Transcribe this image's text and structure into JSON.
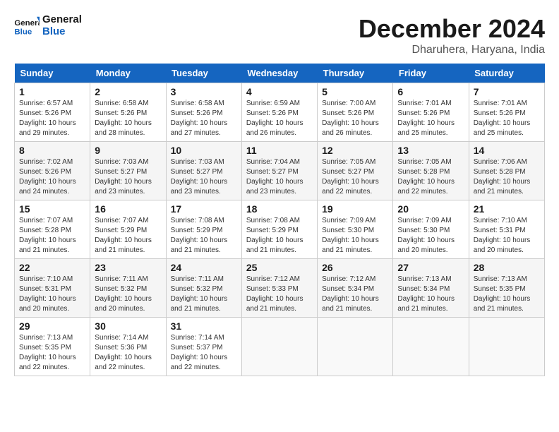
{
  "header": {
    "logo_general": "General",
    "logo_blue": "Blue",
    "month": "December 2024",
    "location": "Dharuhera, Haryana, India"
  },
  "calendar": {
    "days_of_week": [
      "Sunday",
      "Monday",
      "Tuesday",
      "Wednesday",
      "Thursday",
      "Friday",
      "Saturday"
    ],
    "weeks": [
      [
        {
          "day": "",
          "info": ""
        },
        {
          "day": "2",
          "info": "Sunrise: 6:58 AM\nSunset: 5:26 PM\nDaylight: 10 hours\nand 28 minutes."
        },
        {
          "day": "3",
          "info": "Sunrise: 6:58 AM\nSunset: 5:26 PM\nDaylight: 10 hours\nand 27 minutes."
        },
        {
          "day": "4",
          "info": "Sunrise: 6:59 AM\nSunset: 5:26 PM\nDaylight: 10 hours\nand 26 minutes."
        },
        {
          "day": "5",
          "info": "Sunrise: 7:00 AM\nSunset: 5:26 PM\nDaylight: 10 hours\nand 26 minutes."
        },
        {
          "day": "6",
          "info": "Sunrise: 7:01 AM\nSunset: 5:26 PM\nDaylight: 10 hours\nand 25 minutes."
        },
        {
          "day": "7",
          "info": "Sunrise: 7:01 AM\nSunset: 5:26 PM\nDaylight: 10 hours\nand 25 minutes."
        }
      ],
      [
        {
          "day": "1",
          "info": "Sunrise: 6:57 AM\nSunset: 5:26 PM\nDaylight: 10 hours\nand 29 minutes."
        },
        {
          "day": "8",
          "info": ""
        },
        {
          "day": "9",
          "info": ""
        },
        {
          "day": "10",
          "info": ""
        },
        {
          "day": "11",
          "info": ""
        },
        {
          "day": "12",
          "info": ""
        },
        {
          "day": "13",
          "info": ""
        }
      ]
    ],
    "rows": [
      [
        {
          "day": "1",
          "info": "Sunrise: 6:57 AM\nSunset: 5:26 PM\nDaylight: 10 hours\nand 29 minutes."
        },
        {
          "day": "2",
          "info": "Sunrise: 6:58 AM\nSunset: 5:26 PM\nDaylight: 10 hours\nand 28 minutes."
        },
        {
          "day": "3",
          "info": "Sunrise: 6:58 AM\nSunset: 5:26 PM\nDaylight: 10 hours\nand 27 minutes."
        },
        {
          "day": "4",
          "info": "Sunrise: 6:59 AM\nSunset: 5:26 PM\nDaylight: 10 hours\nand 26 minutes."
        },
        {
          "day": "5",
          "info": "Sunrise: 7:00 AM\nSunset: 5:26 PM\nDaylight: 10 hours\nand 26 minutes."
        },
        {
          "day": "6",
          "info": "Sunrise: 7:01 AM\nSunset: 5:26 PM\nDaylight: 10 hours\nand 25 minutes."
        },
        {
          "day": "7",
          "info": "Sunrise: 7:01 AM\nSunset: 5:26 PM\nDaylight: 10 hours\nand 25 minutes."
        }
      ],
      [
        {
          "day": "8",
          "info": "Sunrise: 7:02 AM\nSunset: 5:26 PM\nDaylight: 10 hours\nand 24 minutes."
        },
        {
          "day": "9",
          "info": "Sunrise: 7:03 AM\nSunset: 5:27 PM\nDaylight: 10 hours\nand 23 minutes."
        },
        {
          "day": "10",
          "info": "Sunrise: 7:03 AM\nSunset: 5:27 PM\nDaylight: 10 hours\nand 23 minutes."
        },
        {
          "day": "11",
          "info": "Sunrise: 7:04 AM\nSunset: 5:27 PM\nDaylight: 10 hours\nand 23 minutes."
        },
        {
          "day": "12",
          "info": "Sunrise: 7:05 AM\nSunset: 5:27 PM\nDaylight: 10 hours\nand 22 minutes."
        },
        {
          "day": "13",
          "info": "Sunrise: 7:05 AM\nSunset: 5:28 PM\nDaylight: 10 hours\nand 22 minutes."
        },
        {
          "day": "14",
          "info": "Sunrise: 7:06 AM\nSunset: 5:28 PM\nDaylight: 10 hours\nand 21 minutes."
        }
      ],
      [
        {
          "day": "15",
          "info": "Sunrise: 7:07 AM\nSunset: 5:28 PM\nDaylight: 10 hours\nand 21 minutes."
        },
        {
          "day": "16",
          "info": "Sunrise: 7:07 AM\nSunset: 5:29 PM\nDaylight: 10 hours\nand 21 minutes."
        },
        {
          "day": "17",
          "info": "Sunrise: 7:08 AM\nSunset: 5:29 PM\nDaylight: 10 hours\nand 21 minutes."
        },
        {
          "day": "18",
          "info": "Sunrise: 7:08 AM\nSunset: 5:29 PM\nDaylight: 10 hours\nand 21 minutes."
        },
        {
          "day": "19",
          "info": "Sunrise: 7:09 AM\nSunset: 5:30 PM\nDaylight: 10 hours\nand 21 minutes."
        },
        {
          "day": "20",
          "info": "Sunrise: 7:09 AM\nSunset: 5:30 PM\nDaylight: 10 hours\nand 20 minutes."
        },
        {
          "day": "21",
          "info": "Sunrise: 7:10 AM\nSunset: 5:31 PM\nDaylight: 10 hours\nand 20 minutes."
        }
      ],
      [
        {
          "day": "22",
          "info": "Sunrise: 7:10 AM\nSunset: 5:31 PM\nDaylight: 10 hours\nand 20 minutes."
        },
        {
          "day": "23",
          "info": "Sunrise: 7:11 AM\nSunset: 5:32 PM\nDaylight: 10 hours\nand 20 minutes."
        },
        {
          "day": "24",
          "info": "Sunrise: 7:11 AM\nSunset: 5:32 PM\nDaylight: 10 hours\nand 21 minutes."
        },
        {
          "day": "25",
          "info": "Sunrise: 7:12 AM\nSunset: 5:33 PM\nDaylight: 10 hours\nand 21 minutes."
        },
        {
          "day": "26",
          "info": "Sunrise: 7:12 AM\nSunset: 5:34 PM\nDaylight: 10 hours\nand 21 minutes."
        },
        {
          "day": "27",
          "info": "Sunrise: 7:13 AM\nSunset: 5:34 PM\nDaylight: 10 hours\nand 21 minutes."
        },
        {
          "day": "28",
          "info": "Sunrise: 7:13 AM\nSunset: 5:35 PM\nDaylight: 10 hours\nand 21 minutes."
        }
      ],
      [
        {
          "day": "29",
          "info": "Sunrise: 7:13 AM\nSunset: 5:35 PM\nDaylight: 10 hours\nand 22 minutes."
        },
        {
          "day": "30",
          "info": "Sunrise: 7:14 AM\nSunset: 5:36 PM\nDaylight: 10 hours\nand 22 minutes."
        },
        {
          "day": "31",
          "info": "Sunrise: 7:14 AM\nSunset: 5:37 PM\nDaylight: 10 hours\nand 22 minutes."
        },
        {
          "day": "",
          "info": ""
        },
        {
          "day": "",
          "info": ""
        },
        {
          "day": "",
          "info": ""
        },
        {
          "day": "",
          "info": ""
        }
      ]
    ]
  }
}
